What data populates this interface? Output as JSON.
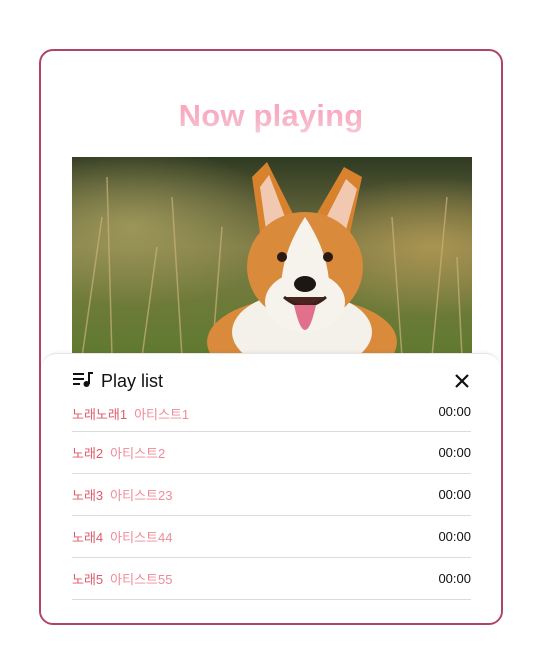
{
  "player": {
    "title": "Now playing"
  },
  "playlist": {
    "heading": "Play list",
    "icon": "queue-music-icon",
    "close_icon": "close-icon",
    "items": [
      {
        "song": "노래노래1",
        "artist": "아티스트1",
        "duration": "00:00"
      },
      {
        "song": "노래2",
        "artist": "아티스트2",
        "duration": "00:00"
      },
      {
        "song": "노래3",
        "artist": "아티스트23",
        "duration": "00:00"
      },
      {
        "song": "노래4",
        "artist": "아티스트44",
        "duration": "00:00"
      },
      {
        "song": "노래5",
        "artist": "아티스트55",
        "duration": "00:00"
      }
    ]
  },
  "colors": {
    "border": "#b0436b",
    "title_gradient_start": "#ff9fb6",
    "song": "#e05a6b",
    "artist": "#ef8b97"
  }
}
